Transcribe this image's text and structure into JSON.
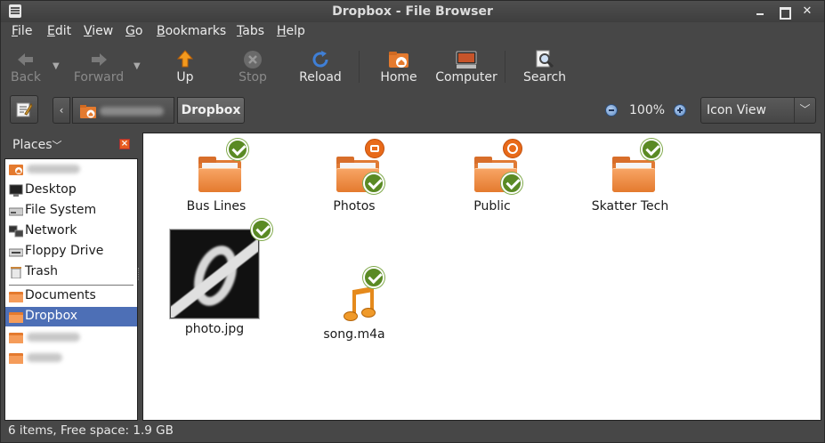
{
  "window": {
    "title": "Dropbox - File Browser"
  },
  "menubar": {
    "items": [
      "File",
      "Edit",
      "View",
      "Go",
      "Bookmarks",
      "Tabs",
      "Help"
    ]
  },
  "toolbar": {
    "back": "Back",
    "forward": "Forward",
    "up": "Up",
    "stop": "Stop",
    "reload": "Reload",
    "home": "Home",
    "computer": "Computer",
    "search": "Search"
  },
  "location": {
    "current": "Dropbox",
    "zoom": "100%",
    "view_mode": "Icon View"
  },
  "sidebar": {
    "header": "Places",
    "items": [
      {
        "label": ""
      },
      {
        "label": "Desktop"
      },
      {
        "label": "File System"
      },
      {
        "label": "Network"
      },
      {
        "label": "Floppy Drive"
      },
      {
        "label": "Trash"
      },
      {
        "label": "Documents"
      },
      {
        "label": "Dropbox"
      },
      {
        "label": ""
      },
      {
        "label": ""
      }
    ]
  },
  "files": [
    {
      "name": "Bus Lines"
    },
    {
      "name": "Photos"
    },
    {
      "name": "Public"
    },
    {
      "name": "Skatter Tech"
    },
    {
      "name": "photo.jpg"
    },
    {
      "name": "song.m4a"
    }
  ],
  "status": {
    "text": "6 items, Free space: 1.9 GB"
  },
  "colors": {
    "folder": "#e47a2e",
    "selection": "#4d6fb6",
    "sync_check": "#5a8a24",
    "emblem": "#e86a1a"
  }
}
